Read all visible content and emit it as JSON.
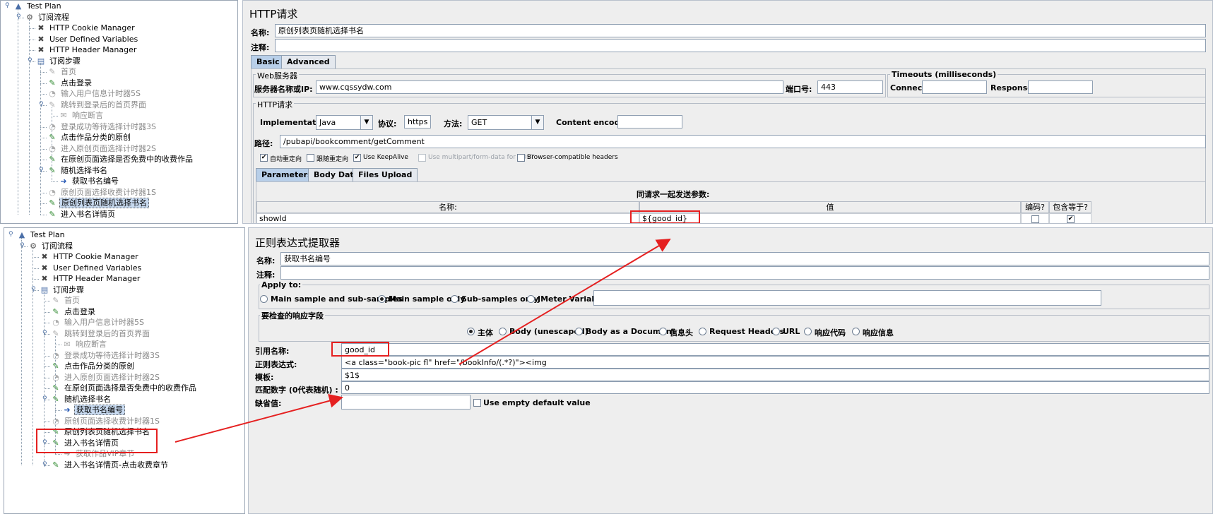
{
  "top_tree": {
    "items": [
      {
        "label": "Test Plan",
        "icon": "test-plan-icon",
        "state": "normal"
      },
      {
        "label": "订阅流程",
        "icon": "thread-group-gear-icon",
        "state": "normal"
      },
      {
        "label": "HTTP Cookie Manager",
        "icon": "wrench-cross-icon",
        "state": "normal"
      },
      {
        "label": "User Defined Variables",
        "icon": "wrench-cross-icon",
        "state": "normal"
      },
      {
        "label": "HTTP Header Manager",
        "icon": "wrench-cross-icon",
        "state": "normal"
      },
      {
        "label": "订阅步骤",
        "icon": "controller-icon",
        "state": "normal"
      },
      {
        "label": "首页",
        "icon": "sampler-pen-icon",
        "state": "disabled"
      },
      {
        "label": "点击登录",
        "icon": "sampler-pen-icon",
        "state": "normal"
      },
      {
        "label": "输入用户信息计时器5S",
        "icon": "timer-icon",
        "state": "disabled"
      },
      {
        "label": "跳转到登录后的首页界面",
        "icon": "sampler-pen-icon",
        "state": "disabled"
      },
      {
        "label": "响应断言",
        "icon": "assertion-icon",
        "state": "disabled"
      },
      {
        "label": "登录成功等待选择计时器3S",
        "icon": "timer-icon",
        "state": "disabled"
      },
      {
        "label": "点击作品分类的原创",
        "icon": "sampler-pen-icon",
        "state": "normal"
      },
      {
        "label": "进入原创页面选择计时器2S",
        "icon": "timer-icon",
        "state": "disabled"
      },
      {
        "label": "在原创页面选择是否免费中的收费作品",
        "icon": "sampler-pen-icon",
        "state": "normal"
      },
      {
        "label": "随机选择书名",
        "icon": "sampler-pen-icon",
        "state": "normal"
      },
      {
        "label": "获取书名编号",
        "icon": "extractor-arrow-icon",
        "state": "normal"
      },
      {
        "label": "原创页面选择收费计时器1S",
        "icon": "timer-icon",
        "state": "disabled"
      },
      {
        "label": "原创列表页随机选择书名",
        "icon": "sampler-pen-icon",
        "state": "selected"
      },
      {
        "label": "进入书名详情页",
        "icon": "sampler-pen-icon",
        "state": "normal"
      }
    ]
  },
  "bottom_tree": {
    "items": [
      {
        "label": "Test Plan",
        "icon": "test-plan-icon",
        "state": "normal"
      },
      {
        "label": "订阅流程",
        "icon": "thread-group-gear-icon",
        "state": "normal"
      },
      {
        "label": "HTTP Cookie Manager",
        "icon": "wrench-cross-icon",
        "state": "normal"
      },
      {
        "label": "User Defined Variables",
        "icon": "wrench-cross-icon",
        "state": "normal"
      },
      {
        "label": "HTTP Header Manager",
        "icon": "wrench-cross-icon",
        "state": "normal"
      },
      {
        "label": "订阅步骤",
        "icon": "controller-icon",
        "state": "normal"
      },
      {
        "label": "首页",
        "icon": "sampler-pen-icon",
        "state": "disabled"
      },
      {
        "label": "点击登录",
        "icon": "sampler-pen-icon",
        "state": "normal"
      },
      {
        "label": "输入用户信息计时器5S",
        "icon": "timer-icon",
        "state": "disabled"
      },
      {
        "label": "跳转到登录后的首页界面",
        "icon": "sampler-pen-icon",
        "state": "disabled"
      },
      {
        "label": "响应断言",
        "icon": "assertion-icon",
        "state": "disabled"
      },
      {
        "label": "登录成功等待选择计时器3S",
        "icon": "timer-icon",
        "state": "disabled"
      },
      {
        "label": "点击作品分类的原创",
        "icon": "sampler-pen-icon",
        "state": "normal"
      },
      {
        "label": "进入原创页面选择计时器2S",
        "icon": "timer-icon",
        "state": "disabled"
      },
      {
        "label": "在原创页面选择是否免费中的收费作品",
        "icon": "sampler-pen-icon",
        "state": "normal"
      },
      {
        "label": "随机选择书名",
        "icon": "sampler-pen-icon",
        "state": "normal"
      },
      {
        "label": "获取书名编号",
        "icon": "extractor-arrow-icon",
        "state": "selected"
      },
      {
        "label": "原创页面选择收费计时器1S",
        "icon": "timer-icon",
        "state": "disabled"
      },
      {
        "label": "原创列表页随机选择书名",
        "icon": "sampler-pen-icon",
        "state": "normal"
      },
      {
        "label": "进入书名详情页",
        "icon": "sampler-pen-icon",
        "state": "normal"
      },
      {
        "label": "获取作品VIP章节",
        "icon": "extractor-arrow-icon",
        "state": "disabled"
      },
      {
        "label": "进入书名详情页-点击收费章节",
        "icon": "sampler-pen-icon",
        "state": "normal"
      }
    ]
  },
  "http_request": {
    "title": "HTTP请求",
    "name_label": "名称:",
    "name_value": "原创列表页随机选择书名",
    "comment_label": "注释:",
    "comment_value": "",
    "tabs": [
      "Basic",
      "Advanced"
    ],
    "web_server_title": "Web服务器",
    "server_label": "服务器名称或IP:",
    "server_value": "www.cqssydw.com",
    "port_label": "端口号:",
    "port_value": "443",
    "timeouts_title": "Timeouts (milliseconds)",
    "connect_label": "Connect:",
    "connect_value": "",
    "response_label": "Response:",
    "response_value": "",
    "http_group_title": "HTTP请求",
    "impl_label": "Implementation:",
    "impl_value": "Java",
    "protocol_label": "协议:",
    "protocol_value": "https",
    "method_label": "方法:",
    "method_value": "GET",
    "encoding_label": "Content encoding:",
    "encoding_value": "",
    "path_label": "路径:",
    "path_value": "/pubapi/bookcomment/getComment",
    "checkboxes": [
      {
        "label": "自动重定向",
        "checked": true,
        "enabled": true
      },
      {
        "label": "跟随重定向",
        "checked": false,
        "enabled": true
      },
      {
        "label": "Use KeepAlive",
        "checked": true,
        "enabled": true
      },
      {
        "label": "Use multipart/form-data for POST",
        "checked": false,
        "enabled": false
      },
      {
        "label": "Browser-compatible headers",
        "checked": false,
        "enabled": true
      }
    ],
    "param_tabs": [
      "Parameters",
      "Body Data",
      "Files Upload"
    ],
    "params_caption": "同请求一起发送参数:",
    "columns": [
      "名称:",
      "值",
      "编码?",
      "包含等于?"
    ],
    "rows": [
      {
        "name": "showId",
        "value": "${good_id}",
        "encode": false,
        "include_equals": true
      }
    ]
  },
  "regex_extractor": {
    "title": "正则表达式提取器",
    "name_label": "名称:",
    "name_value": "获取书名编号",
    "comment_label": "注释:",
    "comment_value": "",
    "apply_to_title": "Apply to:",
    "apply_options": [
      {
        "label": "Main sample and sub-samples",
        "checked": false
      },
      {
        "label": "Main sample only",
        "checked": true
      },
      {
        "label": "Sub-samples only",
        "checked": false
      },
      {
        "label": "JMeter Variable",
        "checked": false
      }
    ],
    "field_title": "要检查的响应字段",
    "field_options": [
      {
        "label": "主体",
        "checked": true
      },
      {
        "label": "Body (unescaped)",
        "checked": false
      },
      {
        "label": "Body as a Document",
        "checked": false
      },
      {
        "label": "信息头",
        "checked": false
      },
      {
        "label": "Request Headers",
        "checked": false
      },
      {
        "label": "URL",
        "checked": false
      },
      {
        "label": "响应代码",
        "checked": false
      },
      {
        "label": "响应信息",
        "checked": false
      }
    ],
    "ref_label": "引用名称:",
    "ref_value": "good_id",
    "regex_label": "正则表达式:",
    "regex_value": "<a class=\"book-pic fl\" href=\"/bookInfo/(.*?)\"><img",
    "template_label": "模板:",
    "template_value": "$1$",
    "match_label": "匹配数字 (0代表随机) :",
    "match_value": "0",
    "default_label": "缺省值:",
    "default_value": "",
    "use_empty_label": "Use empty default value"
  },
  "colors": {
    "annotation": "#e52020",
    "selection": "#c8daf0",
    "tab_active": "#b8cfe9",
    "panel_bg": "#eeeeee"
  }
}
